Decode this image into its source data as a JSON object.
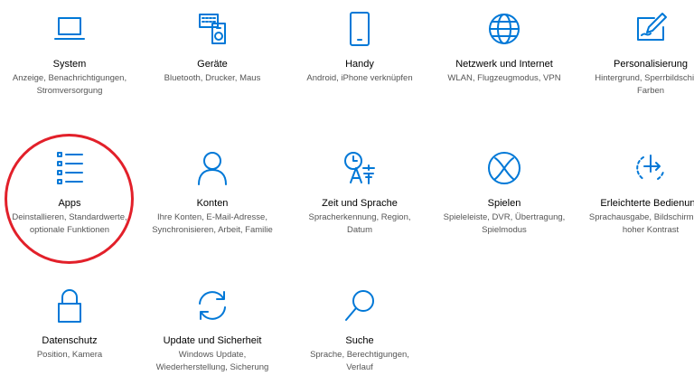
{
  "accent_color": "#0078d7",
  "annotation_color": "#e2202a",
  "tiles": [
    {
      "title": "System",
      "description": "Anzeige, Benachrichtigungen, Stromversorgung",
      "icon": "laptop-icon"
    },
    {
      "title": "Geräte",
      "description": "Bluetooth, Drucker, Maus",
      "icon": "devices-icon"
    },
    {
      "title": "Handy",
      "description": "Android, iPhone verknüpfen",
      "icon": "phone-icon"
    },
    {
      "title": "Netzwerk und Internet",
      "description": "WLAN, Flugzeugmodus, VPN",
      "icon": "globe-icon"
    },
    {
      "title": "Personalisierung",
      "description": "Hintergrund, Sperrbildschirm, Farben",
      "icon": "pen-tablet-icon"
    },
    {
      "title": "Apps",
      "description": "Deinstallieren, Standardwerte, optionale Funktionen",
      "icon": "apps-list-icon"
    },
    {
      "title": "Konten",
      "description": "Ihre Konten, E-Mail-Adresse, Synchronisieren, Arbeit, Familie",
      "icon": "person-icon"
    },
    {
      "title": "Zeit und Sprache",
      "description": "Spracherkennung, Region, Datum",
      "icon": "time-language-icon"
    },
    {
      "title": "Spielen",
      "description": "Spieleleiste, DVR, Übertragung, Spielmodus",
      "icon": "xbox-icon"
    },
    {
      "title": "Erleichterte Bedienung",
      "description": "Sprachausgabe, Bildschirmlupe, hoher Kontrast",
      "icon": "ease-of-access-icon"
    },
    {
      "title": "Datenschutz",
      "description": "Position, Kamera",
      "icon": "lock-icon"
    },
    {
      "title": "Update und Sicherheit",
      "description": "Windows Update, Wiederherstellung, Sicherung",
      "icon": "sync-icon"
    },
    {
      "title": "Suche",
      "description": "Sprache, Berechtigungen, Verlauf",
      "icon": "search-icon"
    }
  ]
}
